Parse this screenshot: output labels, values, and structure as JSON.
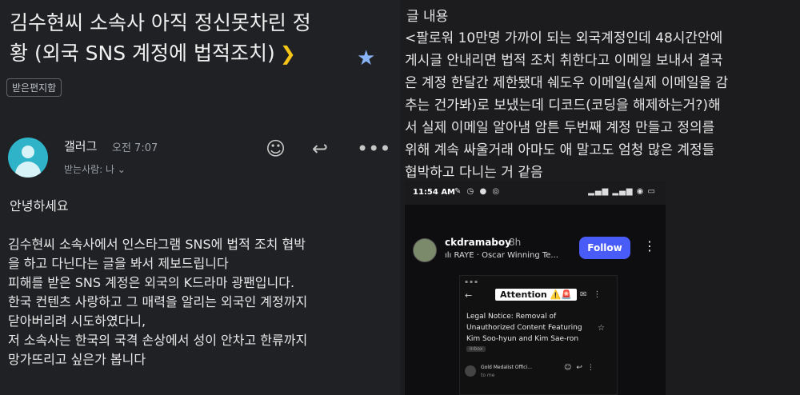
{
  "email": {
    "subject_line1": "김수현씨 소속사 아직 정신못차린 정",
    "subject_line2": "황 (외국 SNS 계정에 법적조치)",
    "label_chip": "받은편지함",
    "sender": "갤러그",
    "time": "오전 7:07",
    "recipient": "받는사람: 나",
    "greeting": "안녕하세요",
    "body_lines": [
      "김수현씨 소속사에서 인스타그램 SNS에 법적 조치 협박",
      "을 하고 다닌다는 글을 봐서 제보드립니다",
      "피해를 받은 SNS 계정은 외국의 K드라마 광팬입니다.",
      "한국 컨텐츠 사랑하고 그 매력을 알리는 외국인 계정까지",
      "닫아버리려 시도하였다니,",
      "저 소속사는 한국의 국격 손상에서 성이 안차고 한류까지",
      "망가뜨리고 싶은가 봅니다"
    ],
    "icons": {
      "important": "chevron-right-icon",
      "star": "star-icon",
      "emoji": "emoji-icon",
      "reply": "reply-icon",
      "more": "more-horizontal-icon"
    }
  },
  "post": {
    "heading": "글 내용",
    "lines": [
      "<팔로워 10만명 가까이 되는 외국계정인데 48시간안에",
      "게시글 안내리면 법적 조치 취한다고 이메일 보내서 결국",
      "은 계정 한달간 제한됐대 쉐도우 이메일(실제 이메일을 감",
      "추는 건가봐)로 보냈는데 디코드(코딩을 해제하는거?)해",
      "서 실제 이메일 알아냄 암튼 두번째 계정 만들고 정의를",
      "위해 계속 싸울거래 아마도 애 말고도 엄청 많은 계정들",
      "협박하고 다니는 거 같음"
    ]
  },
  "phone": {
    "status_time": "11:54 AM",
    "username": "ckdramaboy",
    "age": "8h",
    "song": "RAYE · Oscar Winning Te...",
    "follow_label": "Follow",
    "attention_label": "Attention ⚠️🚨",
    "legal_lines": [
      "Legal Notice: Removal of",
      "Unauthorized Content Featuring",
      "Kim Soo-hyun and Kim Sae-ron"
    ],
    "inbox_chip": "Inbox",
    "gm_sender": "Gold Medalist Offici...",
    "gm_to": "to me"
  },
  "colors": {
    "background": "#202124",
    "important_marker": "#f5c518",
    "star": "#8ab4f8",
    "avatar": "#2fb3c9",
    "follow_button": "#4a5cf7"
  }
}
